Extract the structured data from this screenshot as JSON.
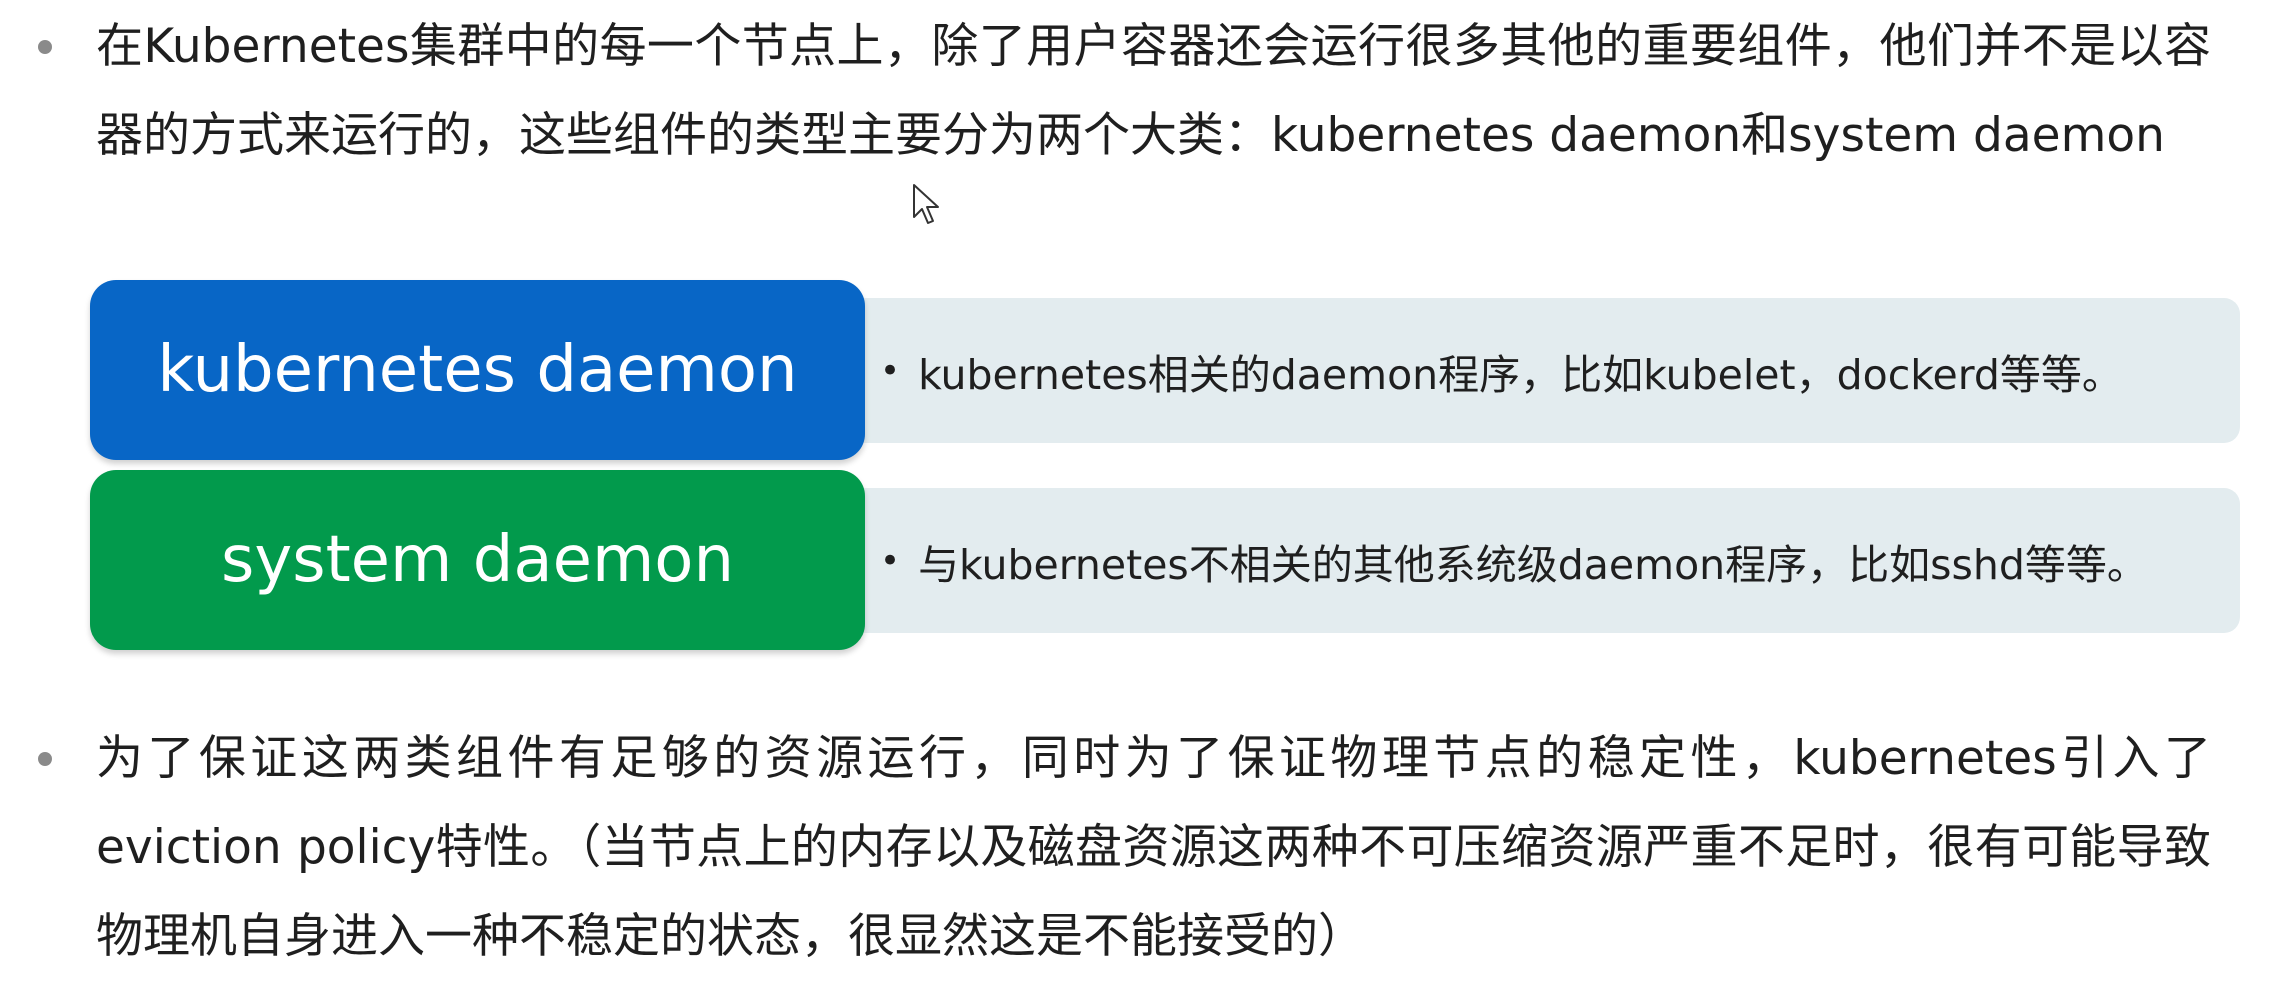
{
  "bullets": [
    {
      "text": "在Kubernetes集群中的每一个节点上，除了用户容器还会运行很多其他的重要组件，他们并不是以容器的方式来运行的，这些组件的类型主要分为两个大类：kubernetes daemon和system daemon"
    },
    {
      "text": "为了保证这两类组件有足够的资源运行，同时为了保证物理节点的稳定性，kubernetes引入了eviction policy特性。（当节点上的内存以及磁盘资源这两种不可压缩资源严重不足时，很有可能导致物理机自身进入一种不稳定的状态，很显然这是不能接受的）"
    }
  ],
  "daemon_types": [
    {
      "label": "kubernetes daemon",
      "description": "kubernetes相关的daemon程序，比如kubelet，dockerd等等。",
      "color": "#0866c6"
    },
    {
      "label": "system daemon",
      "description": "与kubernetes不相关的其他系统级daemon程序，比如sshd等等。",
      "color": "#029a4c"
    }
  ],
  "colors": {
    "description_background": "#e3ecef",
    "bullet": "#8a8a8a"
  },
  "icons": {
    "cursor": "mouse-pointer-icon"
  }
}
